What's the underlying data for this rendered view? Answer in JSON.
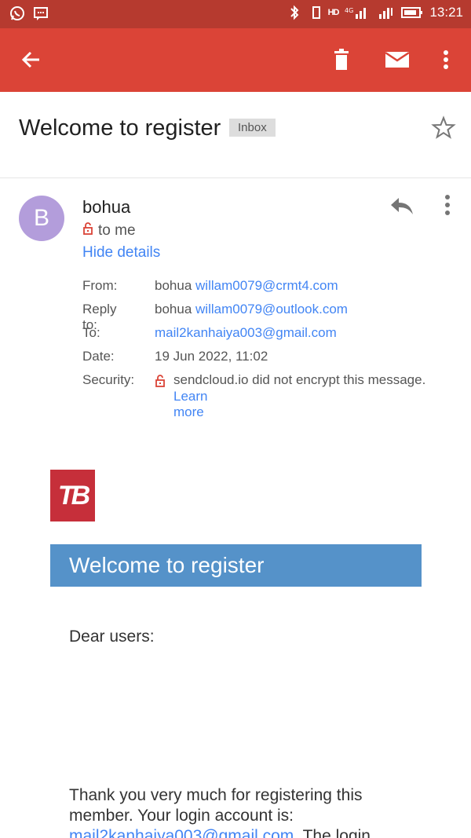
{
  "status_bar": {
    "time": "13:21",
    "left_icons": [
      "whatsapp-icon",
      "message-icon"
    ],
    "right_icons": [
      "bluetooth-icon",
      "vibrate-icon",
      "hd-icon",
      "signal-4g-icon",
      "signal-icon",
      "battery-icon"
    ],
    "hd_label": "HD",
    "net_label": "4G"
  },
  "app_bar": {
    "icons": [
      "back-arrow-icon",
      "delete-icon",
      "mark-unread-icon",
      "more-vert-icon"
    ],
    "color": "#db4437"
  },
  "subject": {
    "title": "Welcome to register",
    "label": "Inbox"
  },
  "sender": {
    "avatar_letter": "B",
    "name": "bohua",
    "to_line": "to me",
    "hide_details": "Hide details"
  },
  "details": {
    "from_label": "From:",
    "from_name": "bohua",
    "from_email": "willam0079@crmt4.com",
    "reply_label": "Reply to:",
    "reply_name": "bohua",
    "reply_email": "willam0079@outlook.com",
    "to_label": "To:",
    "to_email": "mail2kanhaiya003@gmail.com",
    "date_label": "Date:",
    "date_value": "19 Jun 2022, 11:02",
    "security_label": "Security:",
    "security_text": "sendcloud.io did not encrypt this message.",
    "learn_more": "Learn more"
  },
  "email_body": {
    "logo_text": "TB",
    "banner": "Welcome to register",
    "greeting": "Dear users:",
    "paragraph_start": "Thank you very much for registering this member. Your login account is:",
    "paragraph_email": "mail2kanhaiya003@gmail.com",
    "paragraph_end": ". The login"
  }
}
